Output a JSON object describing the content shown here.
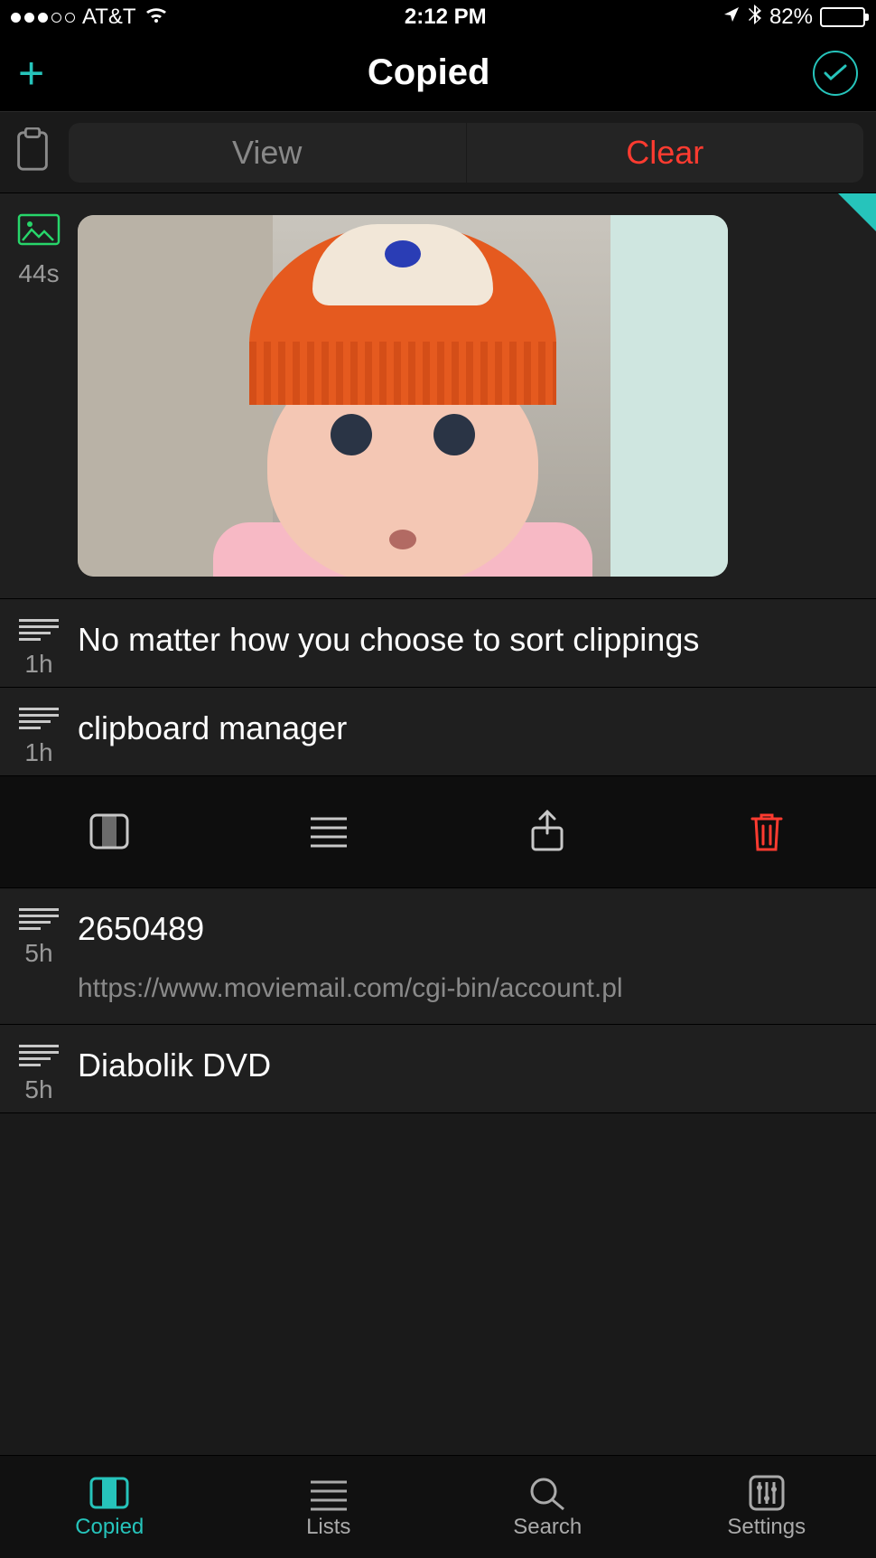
{
  "status": {
    "carrier": "AT&T",
    "time": "2:12 PM",
    "battery_pct": "82%"
  },
  "nav": {
    "title": "Copied"
  },
  "toolbar": {
    "view_label": "View",
    "clear_label": "Clear"
  },
  "clips": [
    {
      "type": "image",
      "time": "44s"
    },
    {
      "type": "text",
      "time": "1h",
      "title": "No matter how you choose to sort clippings"
    },
    {
      "type": "text",
      "time": "1h",
      "title": "clipboard manager"
    },
    {
      "type": "text",
      "time": "5h",
      "title": "2650489",
      "subtitle": "https://www.moviemail.com/cgi-bin/account.pl"
    },
    {
      "type": "text",
      "time": "5h",
      "title": "Diabolik DVD"
    }
  ],
  "tabs": {
    "copied": "Copied",
    "lists": "Lists",
    "search": "Search",
    "settings": "Settings"
  },
  "colors": {
    "accent": "#26c4bb",
    "danger": "#ff3b30",
    "bg": "#1a1a1a"
  }
}
